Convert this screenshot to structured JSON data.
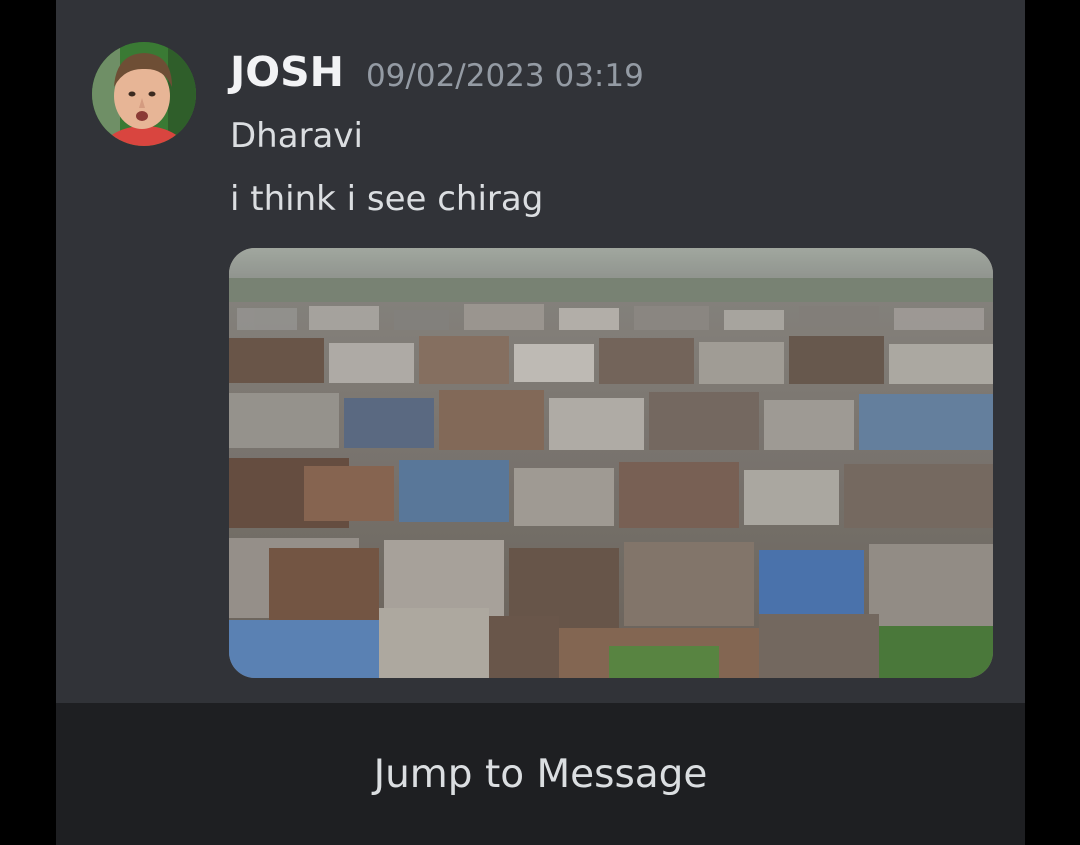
{
  "message": {
    "author": "JOSH",
    "timestamp": "09/02/2023 03:19",
    "lines": [
      "Dharavi",
      "i think i see chirag"
    ]
  },
  "footer": {
    "jump_label": "Jump to Message"
  },
  "colors": {
    "background": "#000000",
    "card": "#313338",
    "footer": "#1e1f22",
    "author": "#f2f3f5",
    "timestamp": "#949ba4",
    "text": "#dbdee1"
  }
}
